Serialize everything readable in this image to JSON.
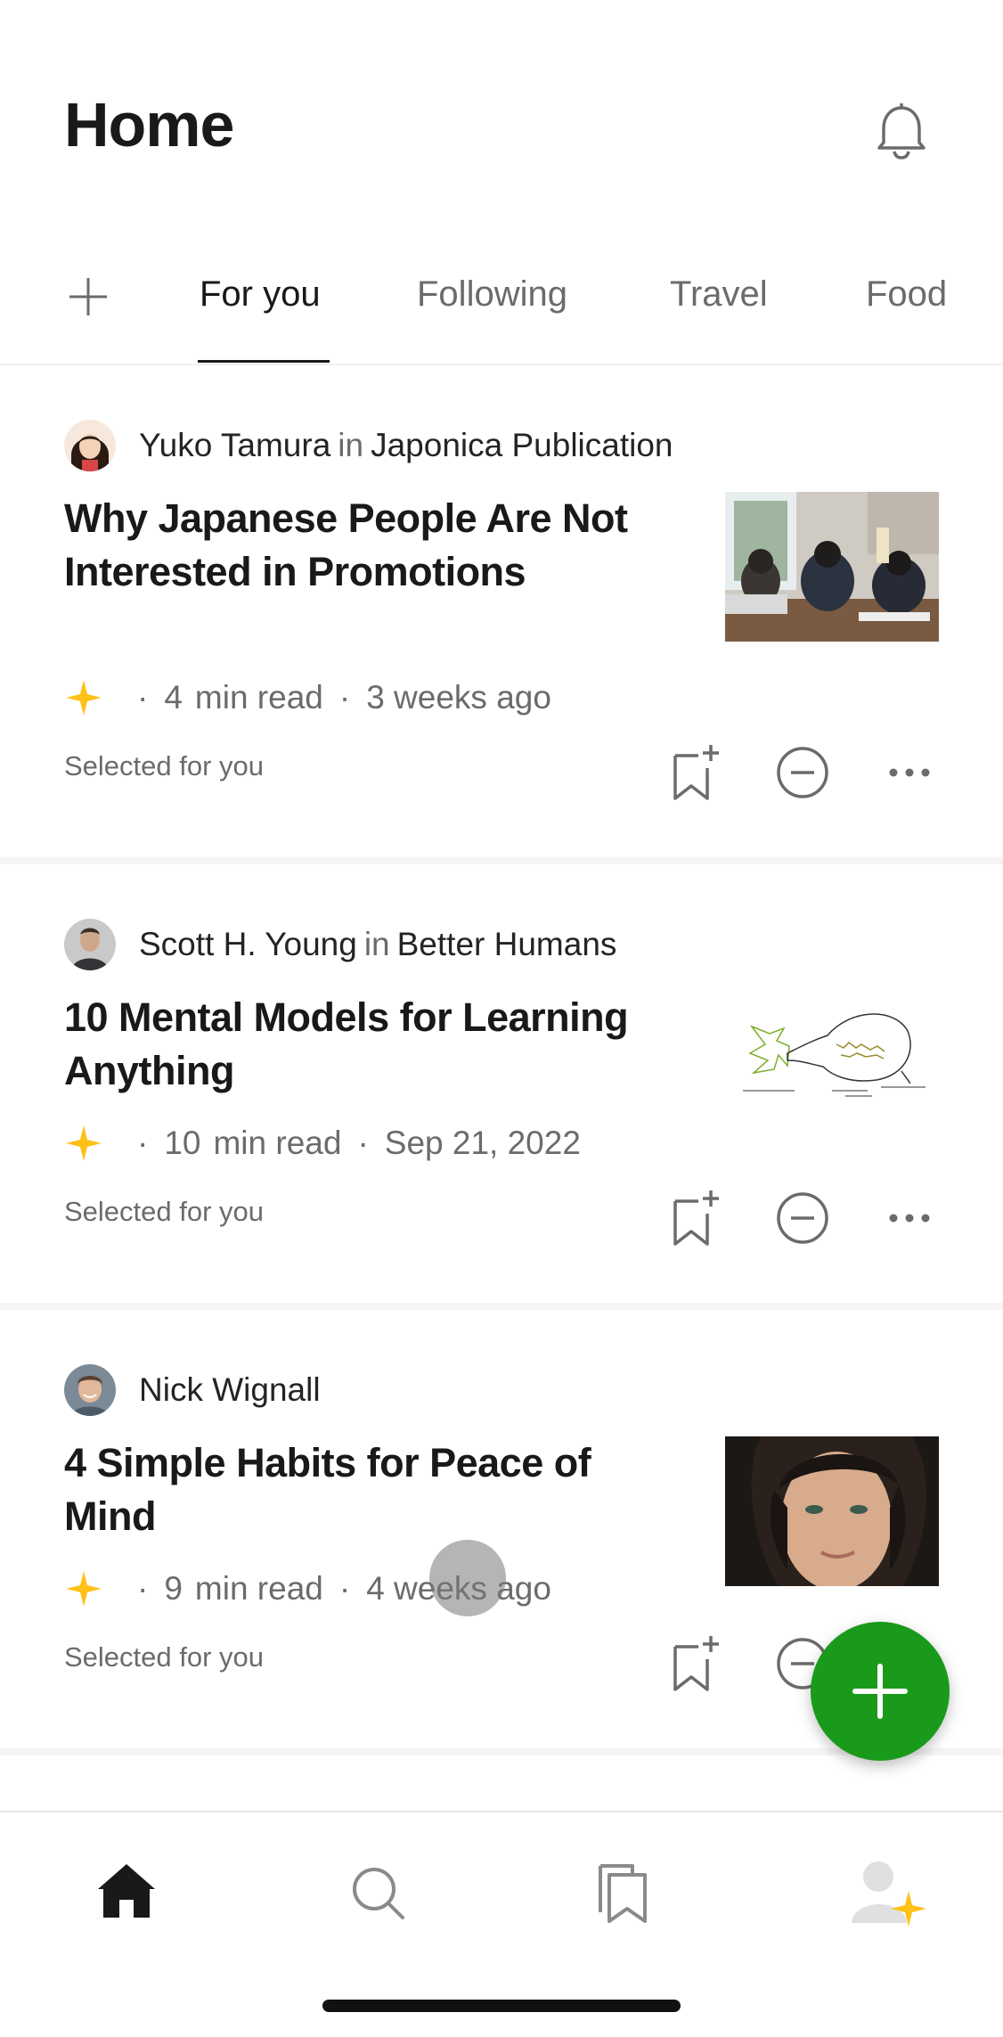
{
  "header": {
    "title": "Home",
    "notification_icon": "bell-icon"
  },
  "tabs": {
    "add_icon": "plus-icon",
    "items": [
      {
        "label": "For you",
        "active": true
      },
      {
        "label": "Following",
        "active": false
      },
      {
        "label": "Travel",
        "active": false
      },
      {
        "label": "Food",
        "active": false
      }
    ]
  },
  "feed": [
    {
      "author": "Yuko Tamura",
      "in_label": "in",
      "publication": "Japonica Publication",
      "title": "Why Japanese People Are Not Interested in Promotions",
      "read_number": "4",
      "read_time": "min read",
      "date": "3 weeks ago",
      "selected_label": "Selected for you",
      "thumbnail": "office-workers-photo"
    },
    {
      "author": "Scott H. Young",
      "in_label": "in",
      "publication": "Better Humans",
      "title": "10 Mental Models for Learning Anything",
      "read_number": "10",
      "read_time": "min read",
      "date": "Sep 21, 2022",
      "selected_label": "Selected for you",
      "thumbnail": "memory-diagram-sketch"
    },
    {
      "author": "Nick Wignall",
      "in_label": "",
      "publication": "",
      "title": "4 Simple Habits for Peace of Mind",
      "read_number": "9",
      "read_time": "min read",
      "date": "4 weeks ago",
      "selected_label": "Selected for you",
      "thumbnail": "woman-portrait-photo"
    }
  ],
  "meta": {
    "member_star_icon": "star-icon",
    "separator": "·"
  },
  "actions": {
    "bookmark_icon": "bookmark-add-icon",
    "dismiss_icon": "minus-circle-icon",
    "more_icon": "more-horizontal-icon"
  },
  "fab": {
    "icon": "plus-icon"
  },
  "bottom_nav": [
    {
      "name": "home",
      "icon": "home-icon",
      "active": true
    },
    {
      "name": "search",
      "icon": "search-icon",
      "active": false
    },
    {
      "name": "library",
      "icon": "bookmarks-icon",
      "active": false
    },
    {
      "name": "profile",
      "icon": "profile-icon",
      "active": false
    }
  ],
  "colors": {
    "accent_green": "#1a9a1a",
    "star_yellow": "#ffc017",
    "text_primary": "#191919",
    "text_secondary": "#6b6b6b"
  }
}
